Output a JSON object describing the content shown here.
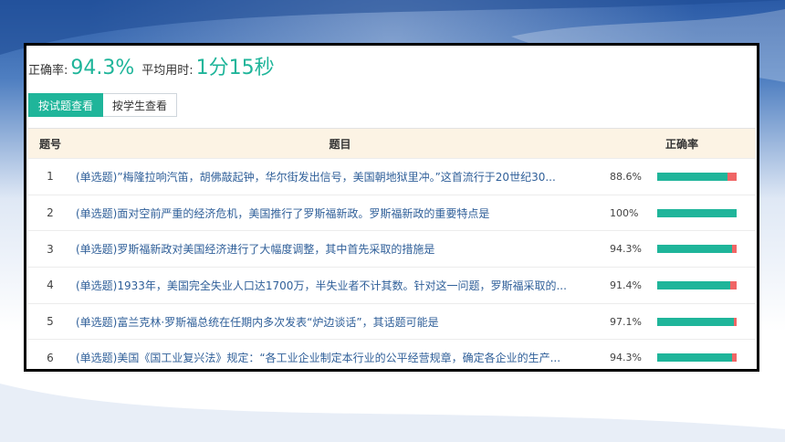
{
  "summary": {
    "accuracy_label": "正确率:",
    "accuracy_value": "94.3%",
    "avg_time_label": "平均用时:",
    "avg_time_value": "1分15秒"
  },
  "tabs": [
    {
      "label": "按试题查看",
      "active": true
    },
    {
      "label": "按学生查看",
      "active": false
    }
  ],
  "table": {
    "headers": {
      "num": "题号",
      "title": "题目",
      "rate": "正确率"
    },
    "rows": [
      {
        "num": "1",
        "title": "(单选题)”梅隆拉响汽笛，胡佛敲起钟，华尔街发出信号，美国朝地狱里冲。”这首流行于20世纪30...",
        "pct": "88.6%",
        "rate": 0.886
      },
      {
        "num": "2",
        "title": "(单选题)面对空前严重的经济危机，美国推行了罗斯福新政。罗斯福新政的重要特点是",
        "pct": "100%",
        "rate": 1.0
      },
      {
        "num": "3",
        "title": "(单选题)罗斯福新政对美国经济进行了大幅度调整，其中首先采取的措施是",
        "pct": "94.3%",
        "rate": 0.943
      },
      {
        "num": "4",
        "title": "(单选题)1933年，美国完全失业人口达1700万，半失业者不计其数。针对这一问题，罗斯福采取的...",
        "pct": "91.4%",
        "rate": 0.914
      },
      {
        "num": "5",
        "title": "(单选题)富兰克林·罗斯福总统在任期内多次发表“炉边谈话”，其话题可能是",
        "pct": "97.1%",
        "rate": 0.971
      },
      {
        "num": "6",
        "title": "(单选题)美国《国工业复兴法》规定：“各工业企业制定本行业的公平经营规章，确定各企业的生产...",
        "pct": "94.3%",
        "rate": 0.943
      }
    ]
  },
  "colors": {
    "accent": "#1fb59a",
    "error": "#f06565",
    "header_bg": "#fcf3e4"
  }
}
